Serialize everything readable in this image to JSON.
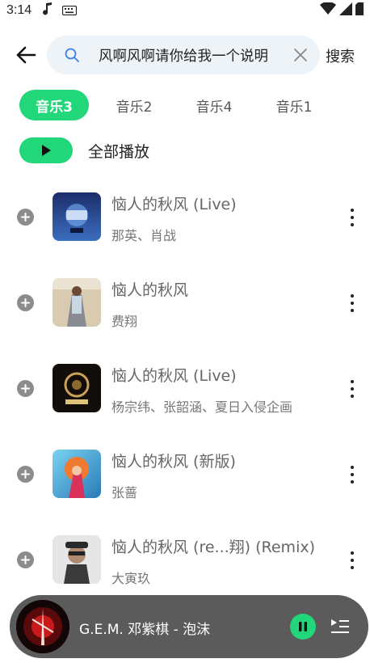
{
  "status_bar": {
    "time": "3:14",
    "icons": [
      "music-note-icon",
      "keyboard-icon",
      "wifi-icon",
      "signal-icon",
      "no-sim-icon"
    ]
  },
  "search": {
    "query": "风啊风啊请你给我一个说明",
    "button_label": "搜索"
  },
  "tabs": [
    {
      "label": "音乐3",
      "active": true
    },
    {
      "label": "音乐2",
      "active": false
    },
    {
      "label": "音乐4",
      "active": false
    },
    {
      "label": "音乐1",
      "active": false
    }
  ],
  "play_all": {
    "label": "全部播放"
  },
  "songs": [
    {
      "title": "恼人的秋风 (Live)",
      "artist": "那英、肖战"
    },
    {
      "title": "恼人的秋风",
      "artist": "费翔"
    },
    {
      "title": "恼人的秋风 (Live)",
      "artist": "杨宗纬、张韶涵、夏日入侵企画"
    },
    {
      "title": "恼人的秋风 (新版)",
      "artist": "张蔷"
    },
    {
      "title": "恼人的秋风 (re...翔) (Remix)",
      "artist": "大寅玖"
    }
  ],
  "now_playing": {
    "title": "G.E.M. 邓紫棋 - 泡沫",
    "state": "playing"
  },
  "colors": {
    "accent": "#22d67a",
    "search_bg": "#eef3f8",
    "player_bg": "#5b5b5b"
  }
}
